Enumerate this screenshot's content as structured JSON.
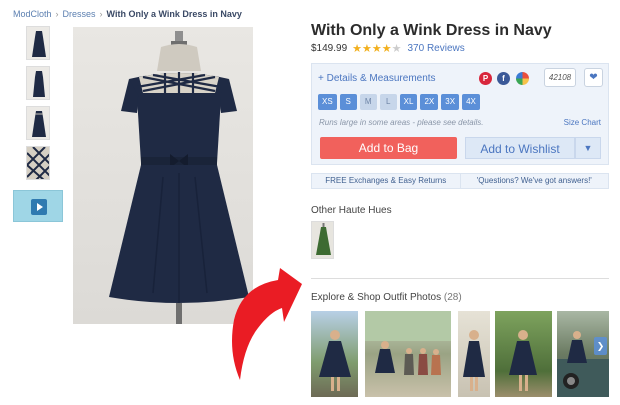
{
  "breadcrumb": {
    "items": [
      "ModCloth",
      "Dresses",
      "With Only a Wink Dress in Navy"
    ],
    "separator": "›"
  },
  "product": {
    "title": "With Only a Wink Dress in Navy",
    "price": "$149.99",
    "rating": 4,
    "rating_max": 5,
    "reviews": "370 Reviews"
  },
  "details": {
    "link": "+ Details & Measurements",
    "social_icons": [
      "pinterest-icon",
      "facebook-icon",
      "pie-icon"
    ],
    "share_count": "42108",
    "favorite_icon": "heart-icon"
  },
  "sizes": [
    "XS",
    "S",
    "M",
    "L",
    "XL",
    "2X",
    "3X",
    "4X"
  ],
  "sizes_unavailable": [
    "M",
    "L"
  ],
  "size_note": "Runs large in some areas - please see details.",
  "size_chart": "Size Chart",
  "buttons": {
    "add_to_bag": "Add to Bag",
    "add_to_wishlist": "Add to Wishlist",
    "caret_icon": "chevron-down-icon"
  },
  "info_strip": [
    "FREE Exchanges & Easy Returns",
    "'Questions? We've got answers!'"
  ],
  "other_hues": {
    "title": "Other Haute Hues"
  },
  "explore": {
    "title": "Explore & Shop Outfit Photos",
    "count": "(28)",
    "next_icon": "chevron-right-icon"
  },
  "colors": {
    "accent_blue": "#5b8fd8",
    "bag_red": "#f1615c",
    "dress_navy": "#1f2a44",
    "arrow_red": "#ea1c24"
  }
}
